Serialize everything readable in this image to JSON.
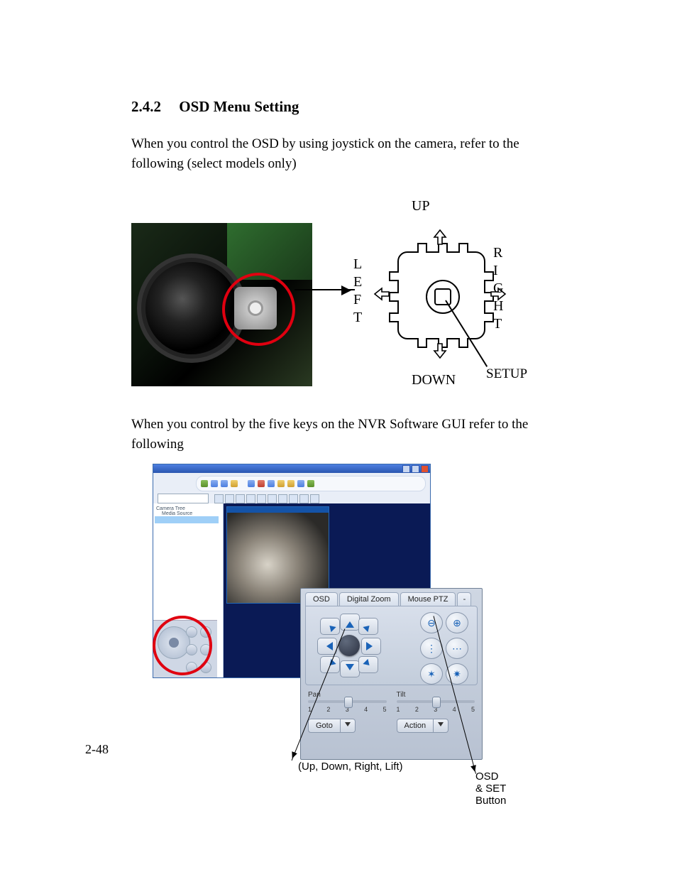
{
  "section": {
    "number": "2.4.2",
    "title": "OSD Menu Setting"
  },
  "para1": "When you control the OSD by using joystick on the camera, refer to the following (select models only)",
  "joystick": {
    "up": "UP",
    "down": "DOWN",
    "setup": "SETUP",
    "left": "L E F T",
    "right": "R I G H T"
  },
  "para2": "When you control by the five keys on the NVR Software GUI refer to the following",
  "nvr": {
    "tree": {
      "root": "Camera Tree",
      "src": "Media Source"
    },
    "ptz": {
      "tabs": {
        "osd": "OSD",
        "digital_zoom": "Digital Zoom",
        "mouse_ptz": "Mouse PTZ",
        "extra": "-"
      },
      "pan": {
        "label": "Pan",
        "ticks": [
          "1",
          "2",
          "3",
          "4",
          "5"
        ],
        "value": 3
      },
      "tilt": {
        "label": "Tilt",
        "ticks": [
          "1",
          "2",
          "3",
          "4",
          "5"
        ],
        "value": 3
      },
      "goto": "Goto",
      "action": "Action"
    }
  },
  "callouts": {
    "dpad": "(Up, Down, Right, Lift)",
    "osd_set": "OSD & SET Button"
  },
  "page_number": "2-48"
}
